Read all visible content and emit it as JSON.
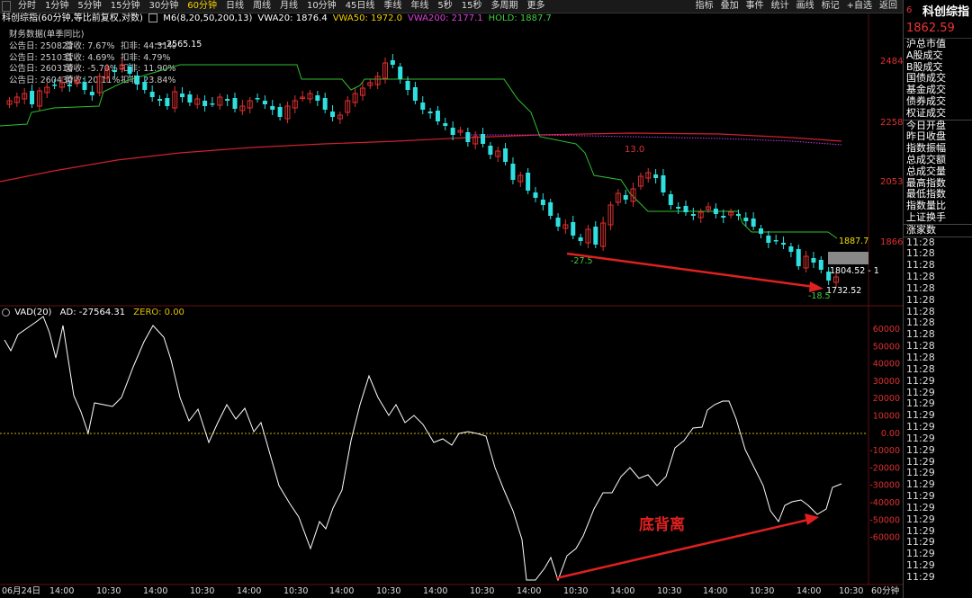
{
  "toolbar": {
    "intervals": [
      "分时",
      "1分钟",
      "5分钟",
      "15分钟",
      "30分钟",
      "60分钟",
      "日线",
      "周线",
      "月线",
      "10分钟",
      "45日线",
      "季线",
      "年线",
      "5秒",
      "15秒",
      "多周期",
      "更多"
    ],
    "active_interval": "60分钟",
    "tools": [
      "指标",
      "叠加",
      "事件",
      "统计",
      "画线",
      "标记",
      "+自选",
      "返回"
    ]
  },
  "chart_header": {
    "instrument": "科创综指(60分钟,等比前复权,对数)",
    "indicators": [
      {
        "label": "M6(8,20,50,200,13)",
        "color": "#ffffff"
      },
      {
        "label": "VWA20: 1876.4",
        "color": "#ffffff"
      },
      {
        "label": "VWA50: 1972.0",
        "color": "#f0d000"
      },
      {
        "label": "VWA200: 2177.1",
        "color": "#e040e0"
      },
      {
        "label": "HOLD: 1887.7",
        "color": "#40d040"
      }
    ]
  },
  "financials": {
    "title": "财务数据(单季同比)",
    "rows": [
      {
        "date": "公告日: 250823",
        "rev": "营收:  7.67%",
        "profit": "扣非:  44.31%"
      },
      {
        "date": "公告日: 251031",
        "rev": "营收:  4.69%",
        "profit": "扣非:  4.79%"
      },
      {
        "date": "公告日: 260316",
        "rev": "营收:  -5.70%",
        "profit": "扣非:  11.90%"
      },
      {
        "date": "公告日: 260430",
        "rev": "营收:  20.11%",
        "profit": "扣非:  23.84%"
      }
    ]
  },
  "price_axis": [
    "2484",
    "2258",
    "2053",
    "1866"
  ],
  "price_annotations": {
    "high": "2565.15",
    "mid_label": "13.0",
    "low1_label": "-27.5",
    "hold_value": "1887.7",
    "last_box": "1804.52 - 1",
    "low2_value": "1732.52",
    "low2_label": "-18.5"
  },
  "vad": {
    "name": "VAD(20)",
    "ad_label": "AD:",
    "ad_value": "-27564.31",
    "zero_label": "ZERO:",
    "zero_value": "0.00",
    "axis": [
      "60000",
      "50000",
      "40000",
      "30000",
      "20000",
      "10000",
      "0.00",
      "-10000",
      "-20000",
      "-30000",
      "-40000",
      "-50000",
      "-60000"
    ],
    "divergence_label": "底背离"
  },
  "time_axis": [
    "06月24日",
    "14:00",
    "10:30",
    "14:00",
    "10:30",
    "14:00",
    "10:30",
    "14:00",
    "10:30",
    "14:00",
    "10:30",
    "14:00",
    "10:30",
    "14:00",
    "10:30",
    "14:00",
    "10:30",
    "14:00",
    "10:30"
  ],
  "time_axis_unit": "60分钟",
  "right_panel": {
    "index_num": "6",
    "name": "科创综指",
    "price": "1862.59",
    "menu": [
      "沪总市值",
      "A股成交",
      "B股成交",
      "国债成交",
      "基金成交",
      "债券成交",
      "权证成交",
      "今日开盘",
      "昨日收盘",
      "指数振幅",
      "总成交额",
      "总成交量",
      "最高指数",
      "最低指数",
      "指数量比",
      "上证换手",
      "涨家数"
    ],
    "times": [
      "11:28",
      "11:28",
      "11:28",
      "11:28",
      "11:28",
      "11:28",
      "11:28",
      "11:28",
      "11:28",
      "11:28",
      "11:28",
      "11:28",
      "11:29",
      "11:29",
      "11:29",
      "11:29",
      "11:29",
      "11:29",
      "11:29",
      "11:29",
      "11:29",
      "11:29",
      "11:29",
      "11:29",
      "11:29",
      "11:29",
      "11:29",
      "11:29",
      "11:29",
      "11:29"
    ]
  },
  "colors": {
    "up": "#e03030",
    "down": "#30e0e0",
    "hold": "#30c030",
    "vwa200": "#d02030",
    "vwa_purple": "#c040e0",
    "arrow": "#e02020",
    "zero": "#d0b000"
  }
}
